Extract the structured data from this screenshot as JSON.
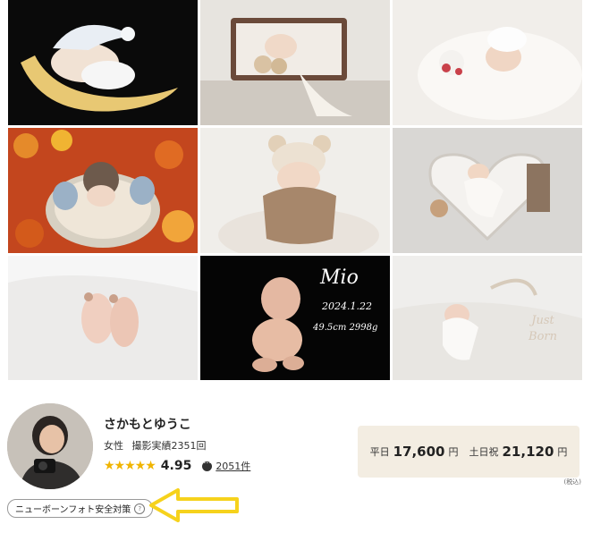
{
  "gallery": {
    "tiles": [
      {
        "scene": "baby sleeping on crescent moon pillow"
      },
      {
        "scene": "baby in wooden crib with teddy bears"
      },
      {
        "scene": "baby with lamb toy on white blanket"
      },
      {
        "scene": "baby in basket on autumn leaves"
      },
      {
        "scene": "baby wrapped with bear ear hat"
      },
      {
        "scene": "baby in heart shaped tray"
      },
      {
        "scene": "baby feet on white fabric"
      },
      {
        "scene": "baby portrait on black with name"
      },
      {
        "scene": "baby wrapped on white bed"
      }
    ],
    "mio_overlay": {
      "name": "Mio",
      "date": "2024.1.22",
      "stats": "49.5cm  2998g"
    },
    "justborn_overlay": {
      "line1": "Just",
      "line2": "Born"
    }
  },
  "profile": {
    "name": "さかもとゆうこ",
    "gender": "女性",
    "shoot_record": "撮影実績2351回",
    "stars": "★★★★★",
    "rating": "4.95",
    "review_count": "2051件",
    "safety_badge": "ニューボーンフォト安全対策",
    "help_icon": "?"
  },
  "pricing": {
    "weekday_label": "平日",
    "weekday_price": "17,600",
    "weekend_label": "土日祝",
    "weekend_price": "21,120",
    "currency": "円",
    "tax_note": "(税込)"
  },
  "colors": {
    "star": "#f0b400",
    "price_bg": "#f3ede2",
    "arrow": "#f6d21c"
  }
}
